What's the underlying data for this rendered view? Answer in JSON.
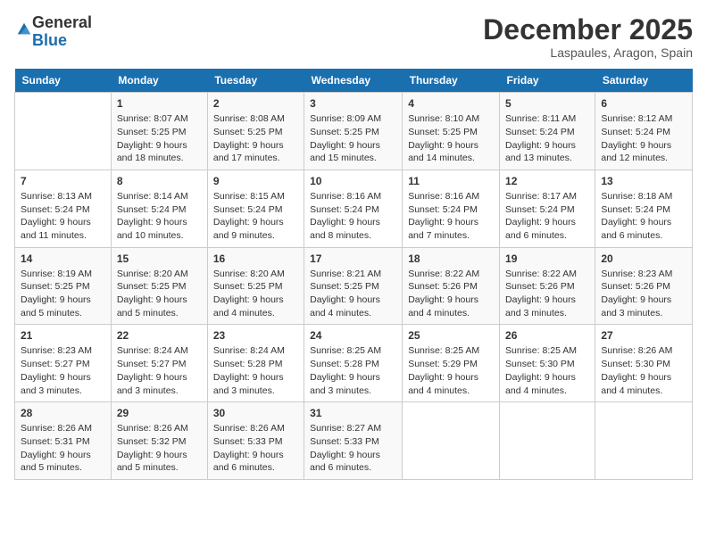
{
  "logo": {
    "general": "General",
    "blue": "Blue"
  },
  "title": "December 2025",
  "subtitle": "Laspaules, Aragon, Spain",
  "days_header": [
    "Sunday",
    "Monday",
    "Tuesday",
    "Wednesday",
    "Thursday",
    "Friday",
    "Saturday"
  ],
  "weeks": [
    [
      {
        "day": "",
        "info": ""
      },
      {
        "day": "1",
        "info": "Sunrise: 8:07 AM\nSunset: 5:25 PM\nDaylight: 9 hours\nand 18 minutes."
      },
      {
        "day": "2",
        "info": "Sunrise: 8:08 AM\nSunset: 5:25 PM\nDaylight: 9 hours\nand 17 minutes."
      },
      {
        "day": "3",
        "info": "Sunrise: 8:09 AM\nSunset: 5:25 PM\nDaylight: 9 hours\nand 15 minutes."
      },
      {
        "day": "4",
        "info": "Sunrise: 8:10 AM\nSunset: 5:25 PM\nDaylight: 9 hours\nand 14 minutes."
      },
      {
        "day": "5",
        "info": "Sunrise: 8:11 AM\nSunset: 5:24 PM\nDaylight: 9 hours\nand 13 minutes."
      },
      {
        "day": "6",
        "info": "Sunrise: 8:12 AM\nSunset: 5:24 PM\nDaylight: 9 hours\nand 12 minutes."
      }
    ],
    [
      {
        "day": "7",
        "info": "Sunrise: 8:13 AM\nSunset: 5:24 PM\nDaylight: 9 hours\nand 11 minutes."
      },
      {
        "day": "8",
        "info": "Sunrise: 8:14 AM\nSunset: 5:24 PM\nDaylight: 9 hours\nand 10 minutes."
      },
      {
        "day": "9",
        "info": "Sunrise: 8:15 AM\nSunset: 5:24 PM\nDaylight: 9 hours\nand 9 minutes."
      },
      {
        "day": "10",
        "info": "Sunrise: 8:16 AM\nSunset: 5:24 PM\nDaylight: 9 hours\nand 8 minutes."
      },
      {
        "day": "11",
        "info": "Sunrise: 8:16 AM\nSunset: 5:24 PM\nDaylight: 9 hours\nand 7 minutes."
      },
      {
        "day": "12",
        "info": "Sunrise: 8:17 AM\nSunset: 5:24 PM\nDaylight: 9 hours\nand 6 minutes."
      },
      {
        "day": "13",
        "info": "Sunrise: 8:18 AM\nSunset: 5:24 PM\nDaylight: 9 hours\nand 6 minutes."
      }
    ],
    [
      {
        "day": "14",
        "info": "Sunrise: 8:19 AM\nSunset: 5:25 PM\nDaylight: 9 hours\nand 5 minutes."
      },
      {
        "day": "15",
        "info": "Sunrise: 8:20 AM\nSunset: 5:25 PM\nDaylight: 9 hours\nand 5 minutes."
      },
      {
        "day": "16",
        "info": "Sunrise: 8:20 AM\nSunset: 5:25 PM\nDaylight: 9 hours\nand 4 minutes."
      },
      {
        "day": "17",
        "info": "Sunrise: 8:21 AM\nSunset: 5:25 PM\nDaylight: 9 hours\nand 4 minutes."
      },
      {
        "day": "18",
        "info": "Sunrise: 8:22 AM\nSunset: 5:26 PM\nDaylight: 9 hours\nand 4 minutes."
      },
      {
        "day": "19",
        "info": "Sunrise: 8:22 AM\nSunset: 5:26 PM\nDaylight: 9 hours\nand 3 minutes."
      },
      {
        "day": "20",
        "info": "Sunrise: 8:23 AM\nSunset: 5:26 PM\nDaylight: 9 hours\nand 3 minutes."
      }
    ],
    [
      {
        "day": "21",
        "info": "Sunrise: 8:23 AM\nSunset: 5:27 PM\nDaylight: 9 hours\nand 3 minutes."
      },
      {
        "day": "22",
        "info": "Sunrise: 8:24 AM\nSunset: 5:27 PM\nDaylight: 9 hours\nand 3 minutes."
      },
      {
        "day": "23",
        "info": "Sunrise: 8:24 AM\nSunset: 5:28 PM\nDaylight: 9 hours\nand 3 minutes."
      },
      {
        "day": "24",
        "info": "Sunrise: 8:25 AM\nSunset: 5:28 PM\nDaylight: 9 hours\nand 3 minutes."
      },
      {
        "day": "25",
        "info": "Sunrise: 8:25 AM\nSunset: 5:29 PM\nDaylight: 9 hours\nand 4 minutes."
      },
      {
        "day": "26",
        "info": "Sunrise: 8:25 AM\nSunset: 5:30 PM\nDaylight: 9 hours\nand 4 minutes."
      },
      {
        "day": "27",
        "info": "Sunrise: 8:26 AM\nSunset: 5:30 PM\nDaylight: 9 hours\nand 4 minutes."
      }
    ],
    [
      {
        "day": "28",
        "info": "Sunrise: 8:26 AM\nSunset: 5:31 PM\nDaylight: 9 hours\nand 5 minutes."
      },
      {
        "day": "29",
        "info": "Sunrise: 8:26 AM\nSunset: 5:32 PM\nDaylight: 9 hours\nand 5 minutes."
      },
      {
        "day": "30",
        "info": "Sunrise: 8:26 AM\nSunset: 5:33 PM\nDaylight: 9 hours\nand 6 minutes."
      },
      {
        "day": "31",
        "info": "Sunrise: 8:27 AM\nSunset: 5:33 PM\nDaylight: 9 hours\nand 6 minutes."
      },
      {
        "day": "",
        "info": ""
      },
      {
        "day": "",
        "info": ""
      },
      {
        "day": "",
        "info": ""
      }
    ]
  ]
}
